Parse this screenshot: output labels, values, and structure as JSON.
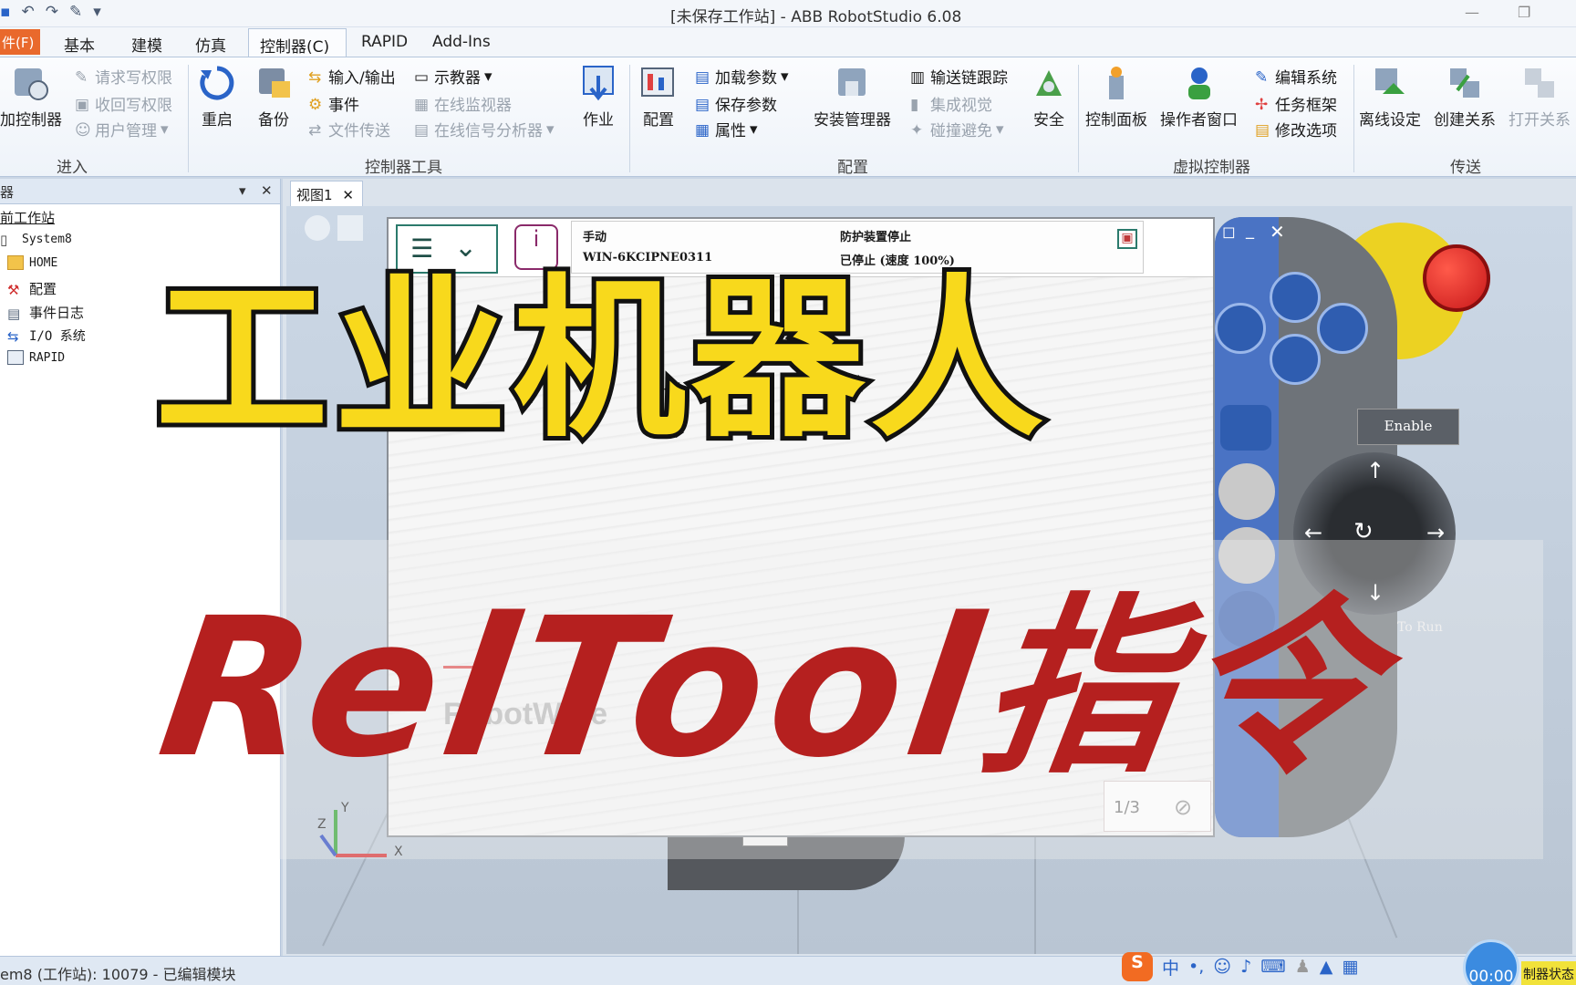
{
  "window": {
    "title": "[未保存工作站] - ABB RobotStudio 6.08"
  },
  "tabs": {
    "file": "件(F)",
    "basic": "基本",
    "modeling": "建模",
    "simulation": "仿真",
    "controller": "控制器(C)",
    "rapid": "RAPID",
    "addins": "Add-Ins"
  },
  "ribbon": {
    "enter": {
      "label": "进入",
      "add_controller": "加控制器",
      "request_write": "请求写权限",
      "release_write": "收回写权限",
      "user_mgmt": "用户管理"
    },
    "controller_tools": {
      "label": "控制器工具",
      "restart": "重启",
      "backup": "备份",
      "io": "输入/输出",
      "events": "事件",
      "file_transfer": "文件传送",
      "flexpendant": "示教器",
      "online_monitor": "在线监视器",
      "signal_analyzer": "在线信号分析器",
      "job": "作业"
    },
    "config": {
      "label": "配置",
      "configure": "配置",
      "load_params": "加载参数",
      "save_params": "保存参数",
      "properties": "属性",
      "install_mgr": "安装管理器",
      "conveyor": "输送链跟踪",
      "integrated_vision": "集成视觉",
      "collision": "碰撞避免",
      "safety": "安全"
    },
    "virtual": {
      "label": "虚拟控制器",
      "control_panel": "控制面板",
      "operator_window": "操作者窗口",
      "edit_system": "编辑系统",
      "task_frame": "任务框架",
      "modify_options": "修改选项"
    },
    "transfer": {
      "label": "传送",
      "offline_setup": "离线设定",
      "create_relation": "创建关系",
      "open_relation": "打开关系"
    }
  },
  "left_pane": {
    "header": "器",
    "station": "前工作站",
    "items": [
      "System8",
      "HOME",
      "配置",
      "事件日志",
      "I/O 系统",
      "RAPID"
    ]
  },
  "document": {
    "tab": "视图1"
  },
  "flexpendant": {
    "mode": "手动",
    "host": "WIN-6KCIPNE0311",
    "guard": "防护装置停止",
    "state": "已停止 (速度 100%)",
    "brand": "RobotWare",
    "fraction": "1/3",
    "enable": "Enable",
    "hold_to_run": "To Run"
  },
  "overlay": {
    "title": "工业机器人",
    "subtitle": "RelTool指令"
  },
  "axes": {
    "x": "X",
    "y": "Y",
    "z": "Z"
  },
  "statusbar": {
    "text": "em8 (工作站): 10079 - 已编辑模块",
    "timer": "00:00",
    "ctrl_state": "制器状态"
  },
  "ime": {
    "lang": "中"
  },
  "colors": {
    "accent_orange": "#e9692c",
    "title_yellow": "#f8d91c",
    "title_red": "#b5201f",
    "flexpendant_blue": "#4a73c4"
  }
}
